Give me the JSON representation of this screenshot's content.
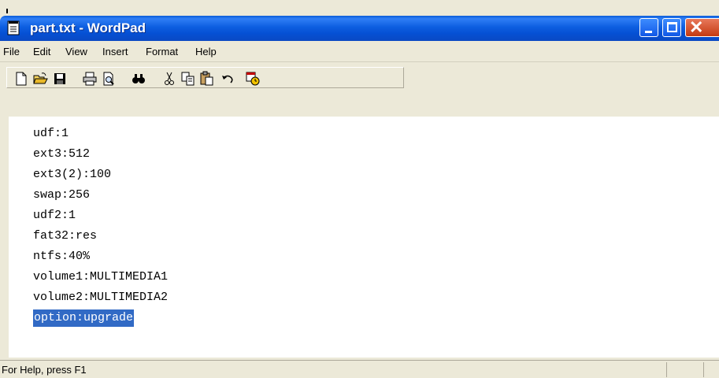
{
  "window": {
    "title": "part.txt - WordPad"
  },
  "colors": {
    "titlebar": "#0a5bd8",
    "selection": "#316ac5",
    "chrome": "#ece9d8"
  },
  "menu": {
    "items": [
      "File",
      "Edit",
      "View",
      "Insert",
      "Format",
      "Help"
    ]
  },
  "toolbar": {
    "icons": [
      "new-icon",
      "open-icon",
      "save-icon",
      "print-icon",
      "print-preview-icon",
      "find-icon",
      "cut-icon",
      "copy-icon",
      "paste-icon",
      "undo-icon",
      "date-time-icon"
    ]
  },
  "document": {
    "lines": [
      "udf:1",
      "ext3:512",
      "ext3(2):100",
      "swap:256",
      "udf2:1",
      "fat32:res",
      "ntfs:40%",
      "volume1:MULTIMEDIA1",
      "volume2:MULTIMEDIA2",
      "option:upgrade"
    ],
    "selected_line": "option:upgrade"
  },
  "status": {
    "text": "For Help, press F1"
  }
}
